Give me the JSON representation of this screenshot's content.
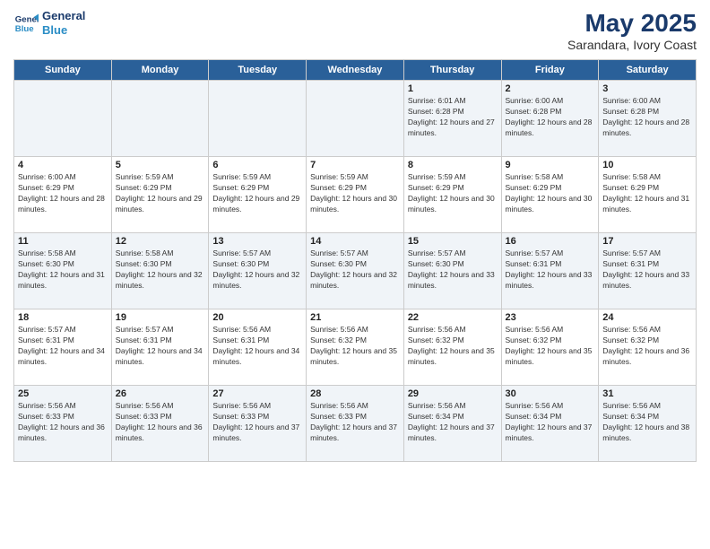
{
  "header": {
    "logo_line1": "General",
    "logo_line2": "Blue",
    "title": "May 2025",
    "subtitle": "Sarandara, Ivory Coast"
  },
  "days_of_week": [
    "Sunday",
    "Monday",
    "Tuesday",
    "Wednesday",
    "Thursday",
    "Friday",
    "Saturday"
  ],
  "weeks": [
    [
      {
        "day": "",
        "info": ""
      },
      {
        "day": "",
        "info": ""
      },
      {
        "day": "",
        "info": ""
      },
      {
        "day": "",
        "info": ""
      },
      {
        "day": "1",
        "info": "Sunrise: 6:01 AM\nSunset: 6:28 PM\nDaylight: 12 hours and 27 minutes."
      },
      {
        "day": "2",
        "info": "Sunrise: 6:00 AM\nSunset: 6:28 PM\nDaylight: 12 hours and 28 minutes."
      },
      {
        "day": "3",
        "info": "Sunrise: 6:00 AM\nSunset: 6:28 PM\nDaylight: 12 hours and 28 minutes."
      }
    ],
    [
      {
        "day": "4",
        "info": "Sunrise: 6:00 AM\nSunset: 6:29 PM\nDaylight: 12 hours and 28 minutes."
      },
      {
        "day": "5",
        "info": "Sunrise: 5:59 AM\nSunset: 6:29 PM\nDaylight: 12 hours and 29 minutes."
      },
      {
        "day": "6",
        "info": "Sunrise: 5:59 AM\nSunset: 6:29 PM\nDaylight: 12 hours and 29 minutes."
      },
      {
        "day": "7",
        "info": "Sunrise: 5:59 AM\nSunset: 6:29 PM\nDaylight: 12 hours and 30 minutes."
      },
      {
        "day": "8",
        "info": "Sunrise: 5:59 AM\nSunset: 6:29 PM\nDaylight: 12 hours and 30 minutes."
      },
      {
        "day": "9",
        "info": "Sunrise: 5:58 AM\nSunset: 6:29 PM\nDaylight: 12 hours and 30 minutes."
      },
      {
        "day": "10",
        "info": "Sunrise: 5:58 AM\nSunset: 6:29 PM\nDaylight: 12 hours and 31 minutes."
      }
    ],
    [
      {
        "day": "11",
        "info": "Sunrise: 5:58 AM\nSunset: 6:30 PM\nDaylight: 12 hours and 31 minutes."
      },
      {
        "day": "12",
        "info": "Sunrise: 5:58 AM\nSunset: 6:30 PM\nDaylight: 12 hours and 32 minutes."
      },
      {
        "day": "13",
        "info": "Sunrise: 5:57 AM\nSunset: 6:30 PM\nDaylight: 12 hours and 32 minutes."
      },
      {
        "day": "14",
        "info": "Sunrise: 5:57 AM\nSunset: 6:30 PM\nDaylight: 12 hours and 32 minutes."
      },
      {
        "day": "15",
        "info": "Sunrise: 5:57 AM\nSunset: 6:30 PM\nDaylight: 12 hours and 33 minutes."
      },
      {
        "day": "16",
        "info": "Sunrise: 5:57 AM\nSunset: 6:31 PM\nDaylight: 12 hours and 33 minutes."
      },
      {
        "day": "17",
        "info": "Sunrise: 5:57 AM\nSunset: 6:31 PM\nDaylight: 12 hours and 33 minutes."
      }
    ],
    [
      {
        "day": "18",
        "info": "Sunrise: 5:57 AM\nSunset: 6:31 PM\nDaylight: 12 hours and 34 minutes."
      },
      {
        "day": "19",
        "info": "Sunrise: 5:57 AM\nSunset: 6:31 PM\nDaylight: 12 hours and 34 minutes."
      },
      {
        "day": "20",
        "info": "Sunrise: 5:56 AM\nSunset: 6:31 PM\nDaylight: 12 hours and 34 minutes."
      },
      {
        "day": "21",
        "info": "Sunrise: 5:56 AM\nSunset: 6:32 PM\nDaylight: 12 hours and 35 minutes."
      },
      {
        "day": "22",
        "info": "Sunrise: 5:56 AM\nSunset: 6:32 PM\nDaylight: 12 hours and 35 minutes."
      },
      {
        "day": "23",
        "info": "Sunrise: 5:56 AM\nSunset: 6:32 PM\nDaylight: 12 hours and 35 minutes."
      },
      {
        "day": "24",
        "info": "Sunrise: 5:56 AM\nSunset: 6:32 PM\nDaylight: 12 hours and 36 minutes."
      }
    ],
    [
      {
        "day": "25",
        "info": "Sunrise: 5:56 AM\nSunset: 6:33 PM\nDaylight: 12 hours and 36 minutes."
      },
      {
        "day": "26",
        "info": "Sunrise: 5:56 AM\nSunset: 6:33 PM\nDaylight: 12 hours and 36 minutes."
      },
      {
        "day": "27",
        "info": "Sunrise: 5:56 AM\nSunset: 6:33 PM\nDaylight: 12 hours and 37 minutes."
      },
      {
        "day": "28",
        "info": "Sunrise: 5:56 AM\nSunset: 6:33 PM\nDaylight: 12 hours and 37 minutes."
      },
      {
        "day": "29",
        "info": "Sunrise: 5:56 AM\nSunset: 6:34 PM\nDaylight: 12 hours and 37 minutes."
      },
      {
        "day": "30",
        "info": "Sunrise: 5:56 AM\nSunset: 6:34 PM\nDaylight: 12 hours and 37 minutes."
      },
      {
        "day": "31",
        "info": "Sunrise: 5:56 AM\nSunset: 6:34 PM\nDaylight: 12 hours and 38 minutes."
      }
    ]
  ]
}
